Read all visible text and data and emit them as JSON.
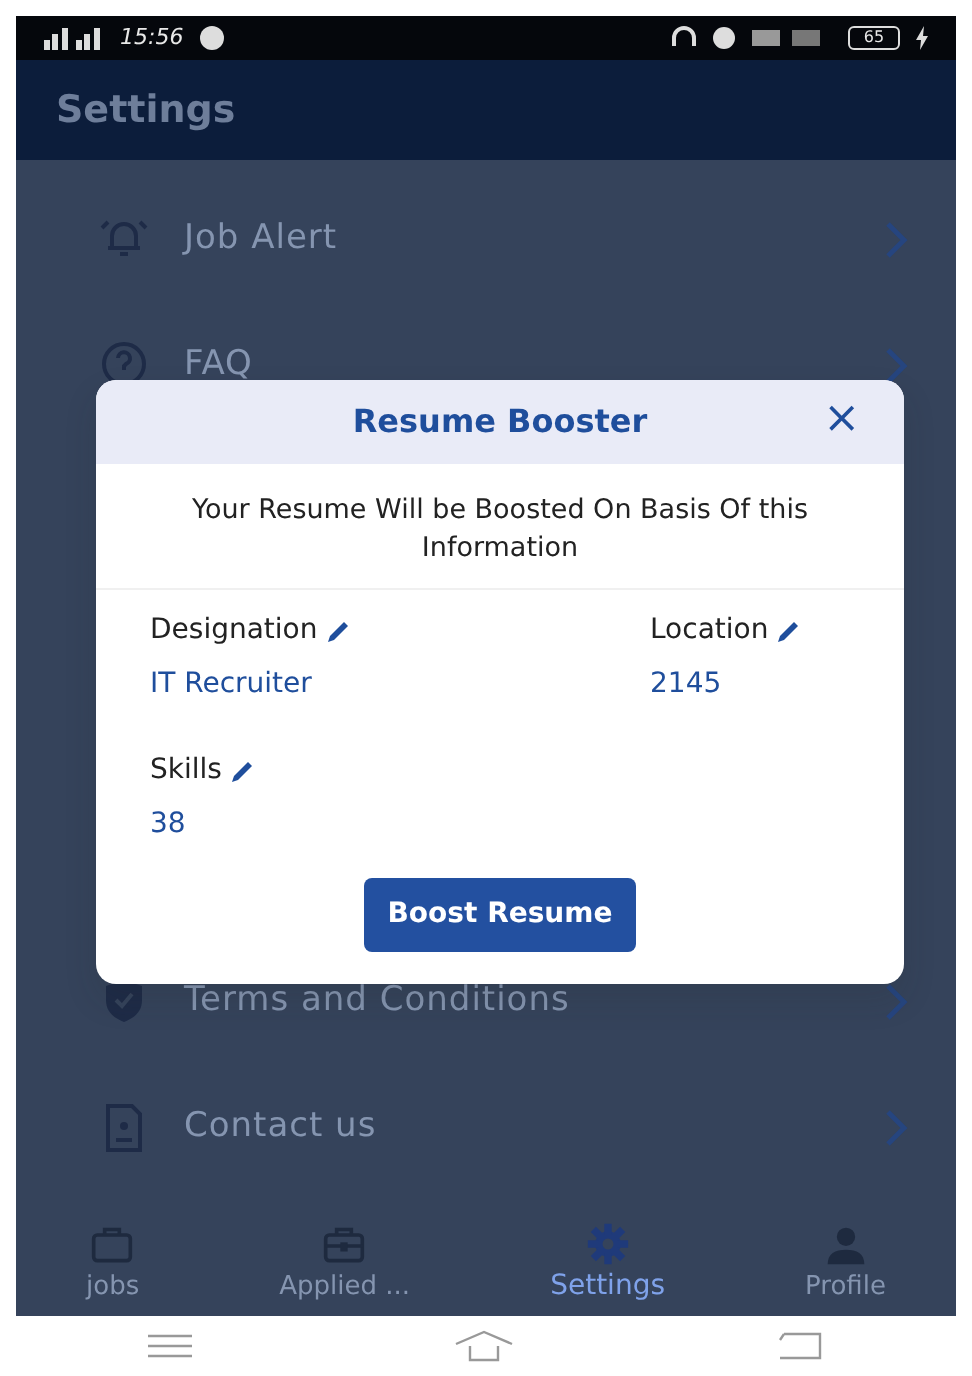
{
  "status_bar": {
    "time": "15:56",
    "battery": "65"
  },
  "header": {
    "title": "Settings"
  },
  "menu": [
    {
      "kind": "bell",
      "label": "Job Alert"
    },
    {
      "kind": "question",
      "label": "FAQ"
    },
    {
      "kind": "shield",
      "label": "Terms and Conditions"
    },
    {
      "kind": "contact",
      "label": "Contact us"
    }
  ],
  "dialog": {
    "title": "Resume Booster",
    "close": "×",
    "message": "Your Resume Will be Boosted On Basis Of this Information",
    "fields": [
      {
        "label": "Designation",
        "value": "IT Recruiter"
      },
      {
        "label": "Location",
        "value": "2145"
      },
      {
        "label": "Skills",
        "value": "38"
      }
    ],
    "button": "Boost Resume"
  },
  "bottom_nav": [
    {
      "kind": "briefcase",
      "label": "jobs",
      "selected": false
    },
    {
      "kind": "toolbox",
      "label": "Applied ...",
      "selected": false
    },
    {
      "kind": "gear",
      "label": "Settings",
      "selected": true
    },
    {
      "kind": "person",
      "label": "Profile",
      "selected": false
    }
  ]
}
